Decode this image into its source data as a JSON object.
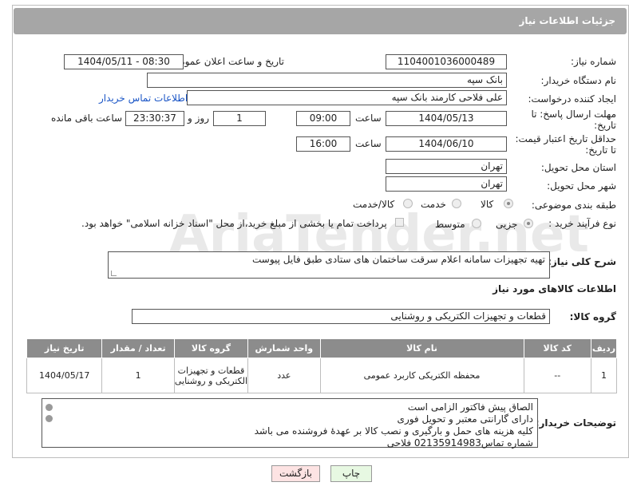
{
  "header": {
    "title": "جزئیات اطلاعات نیاز"
  },
  "fields": {
    "need_number_label": "شماره نیاز:",
    "need_number": "1104001036000489",
    "announce_label": "تاریخ و ساعت اعلان عمومی:",
    "announce_value": "1404/05/11 - 08:30",
    "buyer_org_label": "نام دستگاه خریدار:",
    "buyer_org": "بانک سپه",
    "creator_label": "ایجاد کننده درخواست:",
    "creator": "علی فلاحی کارمند بانک سپه",
    "contact_link": "اطلاعات تماس خریدار",
    "deadline_label_1": "مهلت ارسال پاسخ: تا",
    "deadline_label_2": "تاریخ:",
    "deadline_date": "1404/05/13",
    "time_label": "ساعت",
    "deadline_time": "09:00",
    "days_value": "1",
    "days_label": "روز و",
    "remaining_time": "23:30:37",
    "remaining_label": "ساعت باقی مانده",
    "price_valid_label_1": "حداقل تاریخ اعتبار قیمت:",
    "price_valid_label_2": "تا تاریخ:",
    "price_valid_date": "1404/06/10",
    "price_valid_time": "16:00",
    "province_label": "استان محل تحویل:",
    "province": "تهران",
    "city_label": "شهر محل تحویل:",
    "city": "تهران",
    "category_label": "طبقه بندی موضوعی:",
    "category_options": [
      "کالا",
      "خدمت",
      "کالا/خدمت"
    ],
    "process_label": "نوع فرآیند خرید :",
    "process_options": [
      "جزیی",
      "متوسط"
    ],
    "payment_note": "پرداخت تمام یا بخشی از مبلغ خرید،از محل \"اسناد خزانه اسلامی\" خواهد بود.",
    "summary_label": "شرح کلی نیاز:",
    "summary": "تهیه تجهیزات سامانه اعلام سرقت ساختمان های ستادی طبق فایل پیوست",
    "goods_info_title": "اطلاعات کالاهای مورد نیاز",
    "goods_group_label": "گروه کالا:",
    "goods_group": "قطعات و تجهیزات الکتریکی و روشنایی"
  },
  "table": {
    "headers": [
      "ردیف",
      "کد کالا",
      "نام کالا",
      "واحد شمارش",
      "گروه کالا",
      "تعداد / مقدار",
      "تاریخ نیاز"
    ],
    "rows": [
      [
        "1",
        "--",
        "محفظه الکتریکی کاربرد عمومی",
        "عدد",
        "قطعات و تجهیزات الکتریکی و روشنایی",
        "1",
        "1404/05/17"
      ]
    ]
  },
  "buyer_notes": {
    "label": "توضیحات خریدار:",
    "lines": [
      "الصاق پیش فاکتور الزامی است",
      "دارای گارانتی معتبر و تحویل فوری",
      "کلیه هزینه های حمل و بارگیری و نصب کالا بر عهدهٔ فروشنده می باشد",
      "شماره تماس02135914983 فلاحی"
    ]
  },
  "buttons": {
    "print": "چاپ",
    "back": "بازگشت"
  },
  "watermark": "AriaTender.net",
  "colors": {
    "header_bg": "#a6a6a6",
    "table_header_bg": "#8c8c8c",
    "link": "#1a55c6",
    "back_bg": "#fde3e3",
    "print_bg": "#e7f8e2"
  }
}
